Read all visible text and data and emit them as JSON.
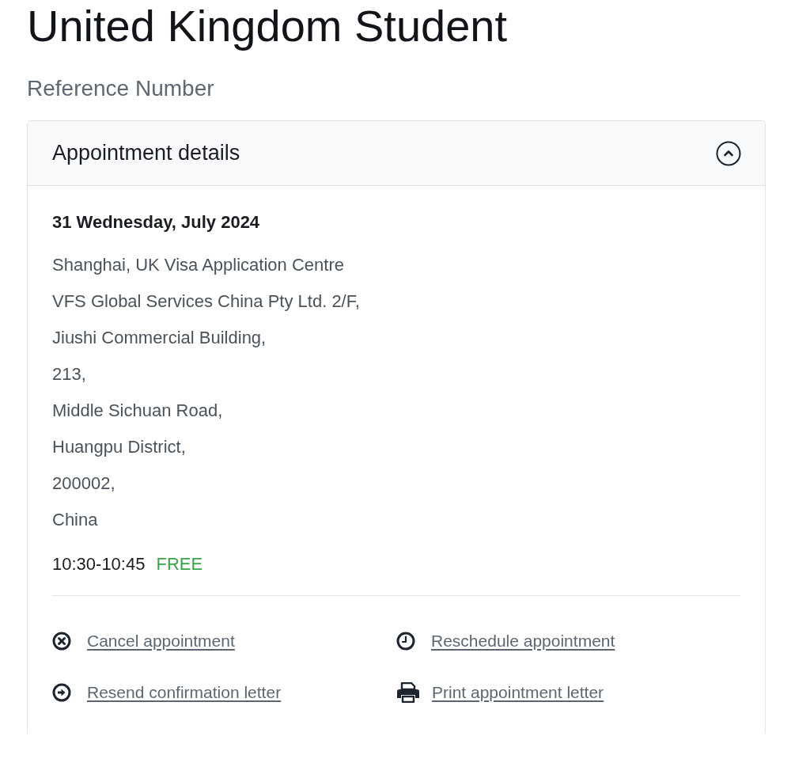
{
  "page": {
    "title": "United Kingdom Student",
    "reference_label": "Reference Number"
  },
  "card": {
    "title": "Appointment details",
    "expanded": true,
    "date": "31 Wednesday, July 2024",
    "address_lines": [
      "Shanghai, UK Visa Application Centre",
      "VFS Global Services China Pty Ltd. 2/F,",
      "Jiushi Commercial Building,",
      "213,",
      "Middle Sichuan Road,",
      "Huangpu District,",
      "200002,",
      "China"
    ],
    "time": "10:30-10:45",
    "price": "FREE",
    "actions": [
      {
        "kind": "cancel",
        "label": "Cancel appointment"
      },
      {
        "kind": "reschedule",
        "label": "Reschedule appointment"
      },
      {
        "kind": "resend",
        "label": "Resend confirmation letter"
      },
      {
        "kind": "print",
        "label": "Print appointment letter"
      }
    ]
  }
}
